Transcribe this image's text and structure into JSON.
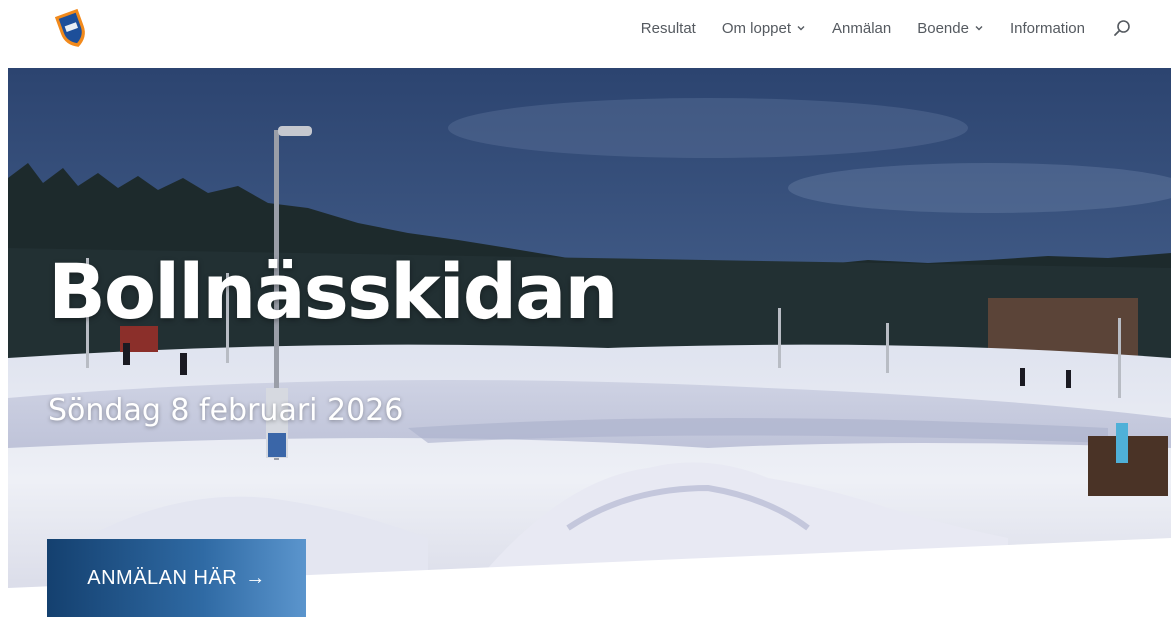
{
  "header": {
    "logo_icon": "club-shield-logo",
    "nav": [
      {
        "label": "Resultat",
        "has_dropdown": false
      },
      {
        "label": "Om loppet",
        "has_dropdown": true
      },
      {
        "label": "Anmälan",
        "has_dropdown": false
      },
      {
        "label": "Boende",
        "has_dropdown": true
      },
      {
        "label": "Information",
        "has_dropdown": false
      }
    ],
    "search_icon": "search-icon"
  },
  "hero": {
    "title": "Bollnässkidan",
    "date": "Söndag 8 februari 2026",
    "cta_label": "ANMÄLAN HÄR",
    "cta_arrow": "→"
  },
  "colors": {
    "nav_text": "#555a60",
    "cta_dark": "#14406f",
    "cta_light": "#5b95cd",
    "sky": "#3a5580"
  }
}
